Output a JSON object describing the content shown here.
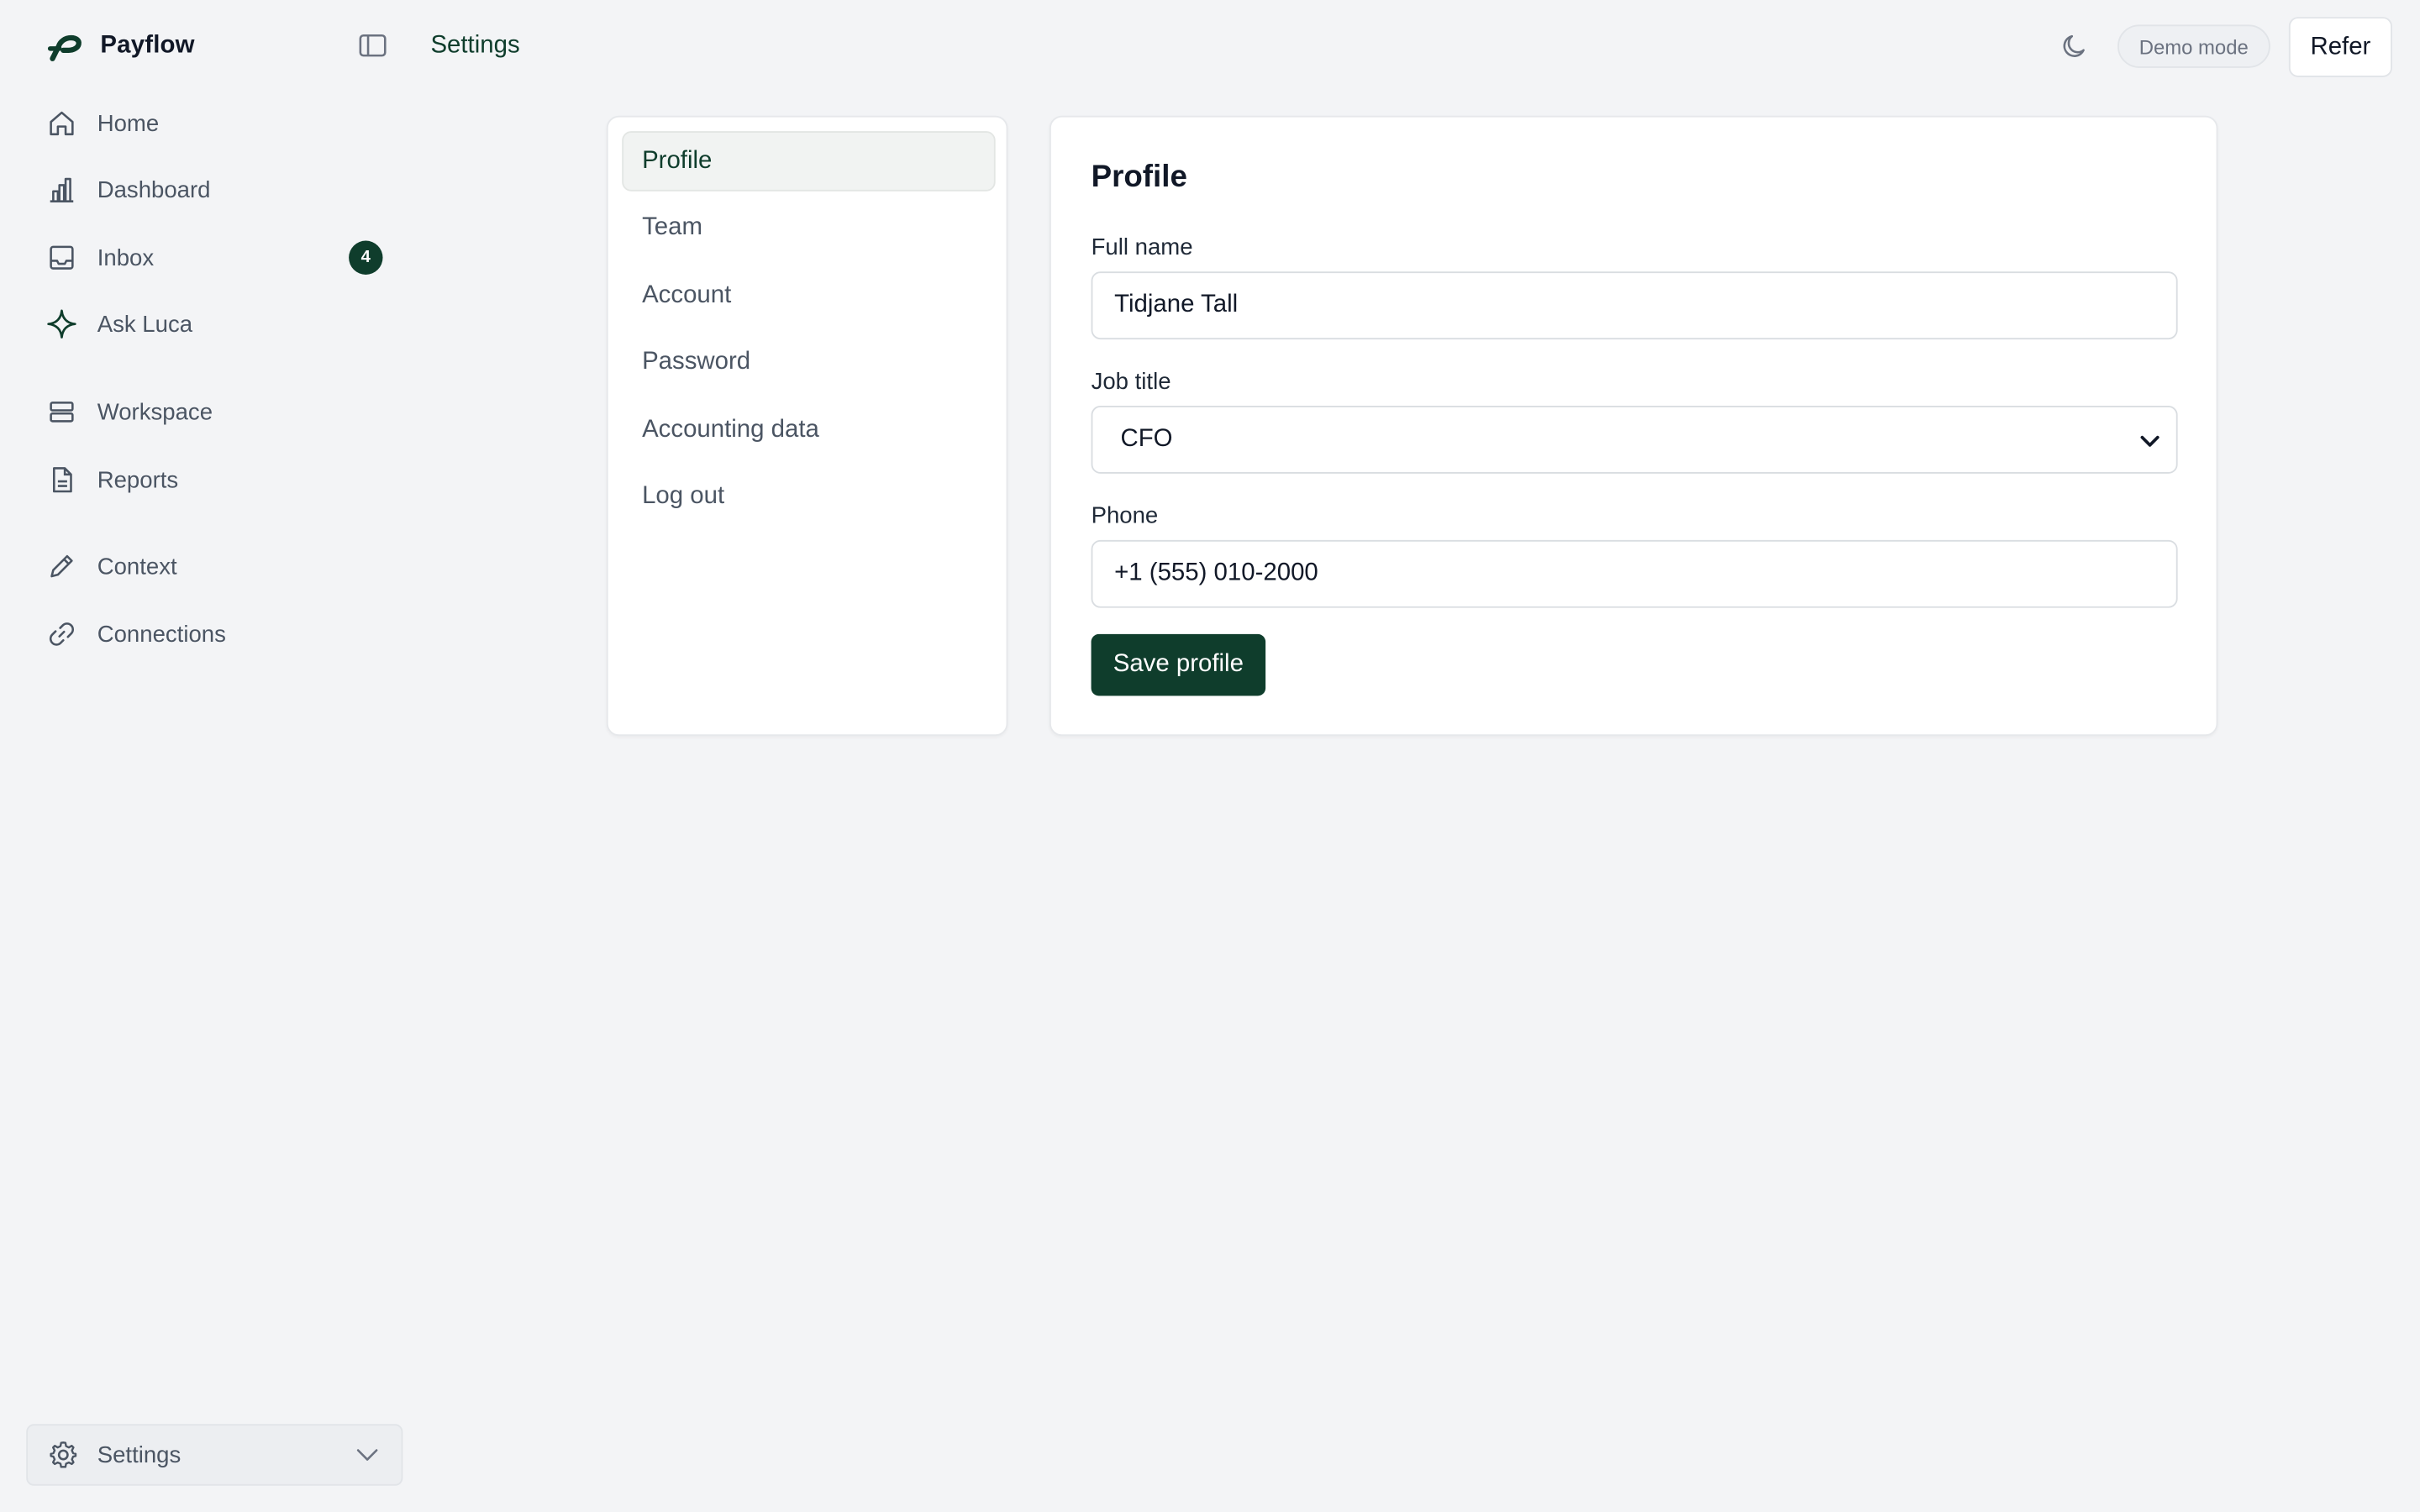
{
  "app": {
    "name": "Payflow"
  },
  "header": {
    "title": "Settings",
    "demo_label": "Demo mode",
    "refer_label": "Refer"
  },
  "sidebar": {
    "items": [
      {
        "label": "Home",
        "icon": "home-icon"
      },
      {
        "label": "Dashboard",
        "icon": "bar-chart-icon"
      },
      {
        "label": "Inbox",
        "icon": "inbox-icon",
        "badge": "4"
      },
      {
        "label": "Ask Luca",
        "icon": "sparkle-icon"
      },
      {
        "label": "Workspace",
        "icon": "database-icon"
      },
      {
        "label": "Reports",
        "icon": "document-icon"
      },
      {
        "label": "Context",
        "icon": "pencil-icon"
      },
      {
        "label": "Connections",
        "icon": "link-icon"
      }
    ],
    "footer": {
      "label": "Settings",
      "icon": "gear-icon"
    }
  },
  "settings_nav": {
    "items": [
      {
        "label": "Profile",
        "active": true
      },
      {
        "label": "Team"
      },
      {
        "label": "Account"
      },
      {
        "label": "Password"
      },
      {
        "label": "Accounting data"
      },
      {
        "label": "Log out"
      }
    ]
  },
  "profile": {
    "title": "Profile",
    "full_name_label": "Full name",
    "full_name_value": "Tidjane Tall",
    "job_title_label": "Job title",
    "job_title_value": "CFO",
    "phone_label": "Phone",
    "phone_value": "+1 (555) 010-2000",
    "save_label": "Save profile"
  },
  "colors": {
    "brand": "#0f3d2c",
    "background": "#f3f4f6"
  }
}
